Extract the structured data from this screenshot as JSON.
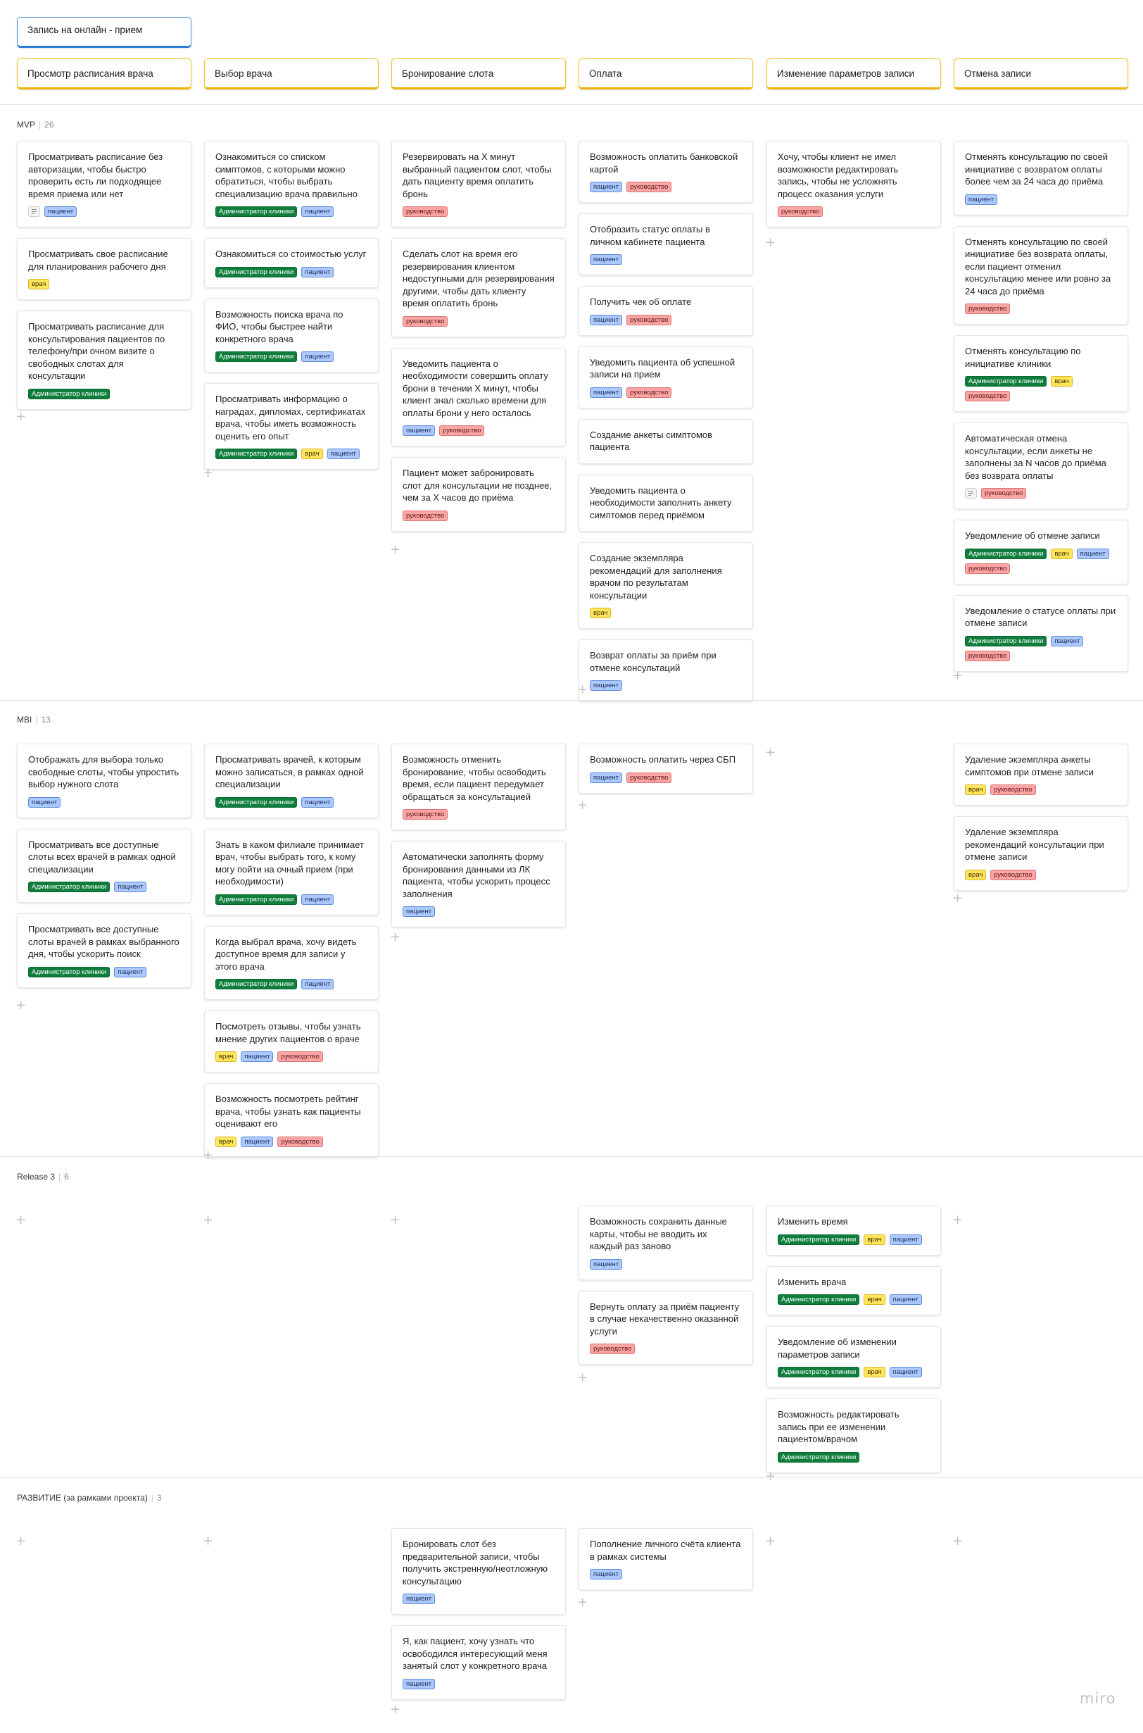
{
  "epic": "Запись на онлайн - прием",
  "activities": [
    "Просмотр расписания врача",
    "Выбор врача",
    "Бронирование слота",
    "Оплата",
    "Изменение параметров записи",
    "Отмена записи"
  ],
  "tag_colors": {
    "admin": "#0f7d3c",
    "patient": "#abc8ff",
    "doctor": "#ffe55c",
    "mgmt": "#fca5a5"
  },
  "releases": [
    {
      "name": "MVP",
      "count": "26",
      "columns": [
        [
          {
            "text": "Просматривать расписание без авторизации, чтобы быстро проверить есть ли подходящее время приема или нет",
            "note": true,
            "tags": [
              {
                "label": "пациент",
                "type": "patient"
              }
            ]
          },
          {
            "text": "Просматривать свое расписание для планирования рабочего дня",
            "tags": [
              {
                "label": "врач",
                "type": "doctor"
              }
            ]
          },
          {
            "text": "Просматривать расписание для консультирования пациентов по телефону/при очном визите о свободных слотах для консультации",
            "tags": [
              {
                "label": "Администратор клиники",
                "type": "admin"
              }
            ]
          }
        ],
        [
          {
            "text": "Ознакомиться со списком симптомов, с которыми можно обратиться, чтобы выбрать специализацию врача правильно",
            "tags": [
              {
                "label": "Администратор клиники",
                "type": "admin"
              },
              {
                "label": "пациент",
                "type": "patient"
              }
            ]
          },
          {
            "text": "Ознакомиться со стоимостью услуг",
            "tags": [
              {
                "label": "Администратор клиники",
                "type": "admin"
              },
              {
                "label": "пациент",
                "type": "patient"
              }
            ]
          },
          {
            "text": "Возможность поиска врача по ФИО, чтобы быстрее найти конкретного врача",
            "tags": [
              {
                "label": "Администратор клиники",
                "type": "admin"
              },
              {
                "label": "пациент",
                "type": "patient"
              }
            ]
          },
          {
            "text": "Просматривать информацию о наградах, дипломах, сертификатах врача, чтобы иметь возможность оценить его опыт",
            "tags": [
              {
                "label": "Администратор клиники",
                "type": "admin"
              },
              {
                "label": "врач",
                "type": "doctor"
              },
              {
                "label": "пациент",
                "type": "patient"
              }
            ]
          }
        ],
        [
          {
            "text": "Резервировать на Х минут выбранный пациентом слот, чтобы дать пациенту время оплатить бронь",
            "tags": [
              {
                "label": "руководство",
                "type": "mgmt"
              }
            ]
          },
          {
            "text": "Сделать слот на время его резервирования клиентом недоступными для резервирования другими, чтобы дать клиенту время оплатить бронь",
            "tags": [
              {
                "label": "руководство",
                "type": "mgmt"
              }
            ]
          },
          {
            "text": "Уведомить пациента о необходимости совершить оплату брони в течении Х минут, чтобы клиент знал сколько времени для оплаты брони у него осталось",
            "tags": [
              {
                "label": "пациент",
                "type": "patient"
              },
              {
                "label": "руководство",
                "type": "mgmt"
              }
            ]
          },
          {
            "text": "Пациент может забронировать слот для консультации не позднее, чем за Х часов до приёма",
            "tags": [
              {
                "label": "руководство",
                "type": "mgmt"
              }
            ]
          }
        ],
        [
          {
            "text": "Возможность оплатить банковской картой",
            "tags": [
              {
                "label": "пациент",
                "type": "patient"
              },
              {
                "label": "руководство",
                "type": "mgmt"
              }
            ]
          },
          {
            "text": "Отобразить статус оплаты в личном кабинете пациента",
            "tags": [
              {
                "label": "пациент",
                "type": "patient"
              }
            ]
          },
          {
            "text": "Получить чек об оплате",
            "tags": [
              {
                "label": "пациент",
                "type": "patient"
              },
              {
                "label": "руководство",
                "type": "mgmt"
              }
            ]
          },
          {
            "text": "Уведомить пациента об успешной записи на прием",
            "tags": [
              {
                "label": "пациент",
                "type": "patient"
              },
              {
                "label": "руководство",
                "type": "mgmt"
              }
            ]
          },
          {
            "text": "Создание анкеты симптомов пациента",
            "tags": []
          },
          {
            "text": "Уведомить пациента о необходимости заполнить анкету симптомов перед приёмом",
            "tags": []
          },
          {
            "text": "Создание экземпляра рекомендаций для заполнения врачом по результатам консультации",
            "tags": [
              {
                "label": "врач",
                "type": "doctor"
              }
            ]
          },
          {
            "text": "Возврат оплаты за приём при отмене консультаций",
            "tags": [
              {
                "label": "пациент",
                "type": "patient"
              }
            ]
          }
        ],
        [
          {
            "text": "Хочу, чтобы клиент не имел возможности редактировать запись, чтобы не усложнять процесс оказания услуги",
            "tags": [
              {
                "label": "руководство",
                "type": "mgmt"
              }
            ]
          }
        ],
        [
          {
            "text": "Отменять консультацию по своей инициативе с возвратом оплаты более чем за 24 часа до приёма",
            "tags": [
              {
                "label": "пациент",
                "type": "patient"
              }
            ]
          },
          {
            "text": "Отменять консультацию по своей инициативе без возврата оплаты, если пациент отменил консультацию менее или ровно за 24 часа до приёма",
            "tags": [
              {
                "label": "руководство",
                "type": "mgmt"
              }
            ]
          },
          {
            "text": "Отменять консультацию по инициативе клиники",
            "tags": [
              {
                "label": "Администратор клиники",
                "type": "admin"
              },
              {
                "label": "врач",
                "type": "doctor"
              },
              {
                "label": "руководство",
                "type": "mgmt"
              }
            ]
          },
          {
            "text": "Автоматическая отмена консультации, если анкеты не заполнены за N часов до приёма без возврата оплаты",
            "note": true,
            "tags": [
              {
                "label": "руководство",
                "type": "mgmt"
              }
            ]
          },
          {
            "text": "Уведомление об отмене записи",
            "tags": [
              {
                "label": "Администратор клиники",
                "type": "admin"
              },
              {
                "label": "врач",
                "type": "doctor"
              },
              {
                "label": "пациент",
                "type": "patient"
              },
              {
                "label": "руководство",
                "type": "mgmt"
              }
            ]
          },
          {
            "text": "Уведомление о статусе оплаты при отмене записи",
            "tags": [
              {
                "label": "Администратор клиники",
                "type": "admin"
              },
              {
                "label": "пациент",
                "type": "patient"
              },
              {
                "label": "руководство",
                "type": "mgmt"
              }
            ]
          }
        ]
      ]
    },
    {
      "name": "MBI",
      "count": "13",
      "columns": [
        [
          {
            "text": "Отображать для выбора только свободные слоты, чтобы упростить выбор нужного слота",
            "tags": [
              {
                "label": "пациент",
                "type": "patient"
              }
            ]
          },
          {
            "text": "Просматривать все доступные слоты всех врачей в рамках одной специализации",
            "tags": [
              {
                "label": "Администратор клиники",
                "type": "admin"
              },
              {
                "label": "пациент",
                "type": "patient"
              }
            ]
          },
          {
            "text": "Просматривать все доступные слоты врачей в рамках выбранного дня, чтобы ускорить поиск",
            "tags": [
              {
                "label": "Администратор клиники",
                "type": "admin"
              },
              {
                "label": "пациент",
                "type": "patient"
              }
            ]
          }
        ],
        [
          {
            "text": "Просматривать врачей, к которым можно записаться, в рамках одной специализации",
            "tags": [
              {
                "label": "Администратор клиники",
                "type": "admin"
              },
              {
                "label": "пациент",
                "type": "patient"
              }
            ]
          },
          {
            "text": "Знать в каком филиале принимает врач, чтобы выбрать того, к кому могу пойти на очный прием (при необходимости)",
            "tags": [
              {
                "label": "Администратор клиники",
                "type": "admin"
              },
              {
                "label": "пациент",
                "type": "patient"
              }
            ]
          },
          {
            "text": "Когда выбрал врача, хочу видеть доступное время для записи у этого врача",
            "tags": [
              {
                "label": "Администратор клиники",
                "type": "admin"
              },
              {
                "label": "пациент",
                "type": "patient"
              }
            ]
          },
          {
            "text": "Посмотреть отзывы, чтобы узнать мнение других пациентов о враче",
            "tags": [
              {
                "label": "врач",
                "type": "doctor"
              },
              {
                "label": "пациент",
                "type": "patient"
              },
              {
                "label": "руководство",
                "type": "mgmt"
              }
            ]
          },
          {
            "text": "Возможность посмотреть рейтинг врача, чтобы узнать как пациенты оценивают его",
            "tags": [
              {
                "label": "врач",
                "type": "doctor"
              },
              {
                "label": "пациент",
                "type": "patient"
              },
              {
                "label": "руководство",
                "type": "mgmt"
              }
            ]
          }
        ],
        [
          {
            "text": "Возможность отменить бронирование, чтобы освободить время, если пациент передумает обращаться за консультацией",
            "tags": [
              {
                "label": "руководство",
                "type": "mgmt"
              }
            ]
          },
          {
            "text": "Автоматически заполнять форму бронирования данными из ЛК пациента, чтобы ускорить процесс заполнения",
            "tags": [
              {
                "label": "пациент",
                "type": "patient"
              }
            ]
          }
        ],
        [
          {
            "text": "Возможность оплатить через СБП",
            "tags": [
              {
                "label": "пациент",
                "type": "patient"
              },
              {
                "label": "руководство",
                "type": "mgmt"
              }
            ]
          }
        ],
        [],
        [
          {
            "text": "Удаление экземпляра анкеты симптомов при отмене записи",
            "tags": [
              {
                "label": "врач",
                "type": "doctor"
              },
              {
                "label": "руководство",
                "type": "mgmt"
              }
            ]
          },
          {
            "text": "Удаление экземпляра рекомендаций консультации при отмене записи",
            "tags": [
              {
                "label": "врач",
                "type": "doctor"
              },
              {
                "label": "руководство",
                "type": "mgmt"
              }
            ]
          }
        ]
      ]
    },
    {
      "name": "Release 3",
      "count": "6",
      "columns": [
        [],
        [],
        [],
        [
          {
            "text": "Возможность сохранить данные карты, чтобы не вводить их каждый раз заново",
            "tags": [
              {
                "label": "пациент",
                "type": "patient"
              }
            ]
          },
          {
            "text": "Вернуть оплату за приём пациенту в случае некачественно оказанной услуги",
            "tags": [
              {
                "label": "руководство",
                "type": "mgmt"
              }
            ]
          }
        ],
        [
          {
            "text": "Изменить время",
            "tags": [
              {
                "label": "Администратор клиники",
                "type": "admin"
              },
              {
                "label": "врач",
                "type": "doctor"
              },
              {
                "label": "пациент",
                "type": "patient"
              }
            ]
          },
          {
            "text": "Изменить врача",
            "tags": [
              {
                "label": "Администратор клиники",
                "type": "admin"
              },
              {
                "label": "врач",
                "type": "doctor"
              },
              {
                "label": "пациент",
                "type": "patient"
              }
            ]
          },
          {
            "text": "Уведомление об изменении параметров записи",
            "tags": [
              {
                "label": "Администратор клиники",
                "type": "admin"
              },
              {
                "label": "врач",
                "type": "doctor"
              },
              {
                "label": "пациент",
                "type": "patient"
              }
            ]
          },
          {
            "text": "Возможность редактировать запись при ее изменении пациентом/врачом",
            "tags": [
              {
                "label": "Администратор клиники",
                "type": "admin"
              }
            ]
          }
        ],
        []
      ]
    },
    {
      "name": "РАЗВИТИЕ (за рамками проекта)",
      "count": "3",
      "columns": [
        [],
        [],
        [
          {
            "text": "Бронировать слот без предварительной записи, чтобы получить экстренную/неотложную консультацию",
            "tags": [
              {
                "label": "пациент",
                "type": "patient"
              }
            ]
          },
          {
            "text": "Я, как пациент, хочу узнать что освободился интересующий меня занятый слот у конкретного врача",
            "tags": [
              {
                "label": "пациент",
                "type": "patient"
              }
            ]
          }
        ],
        [
          {
            "text": "Пополнение личного счёта клиента в рамках системы",
            "tags": [
              {
                "label": "пациент",
                "type": "patient"
              }
            ]
          }
        ],
        [],
        []
      ]
    }
  ],
  "brand": "miro"
}
